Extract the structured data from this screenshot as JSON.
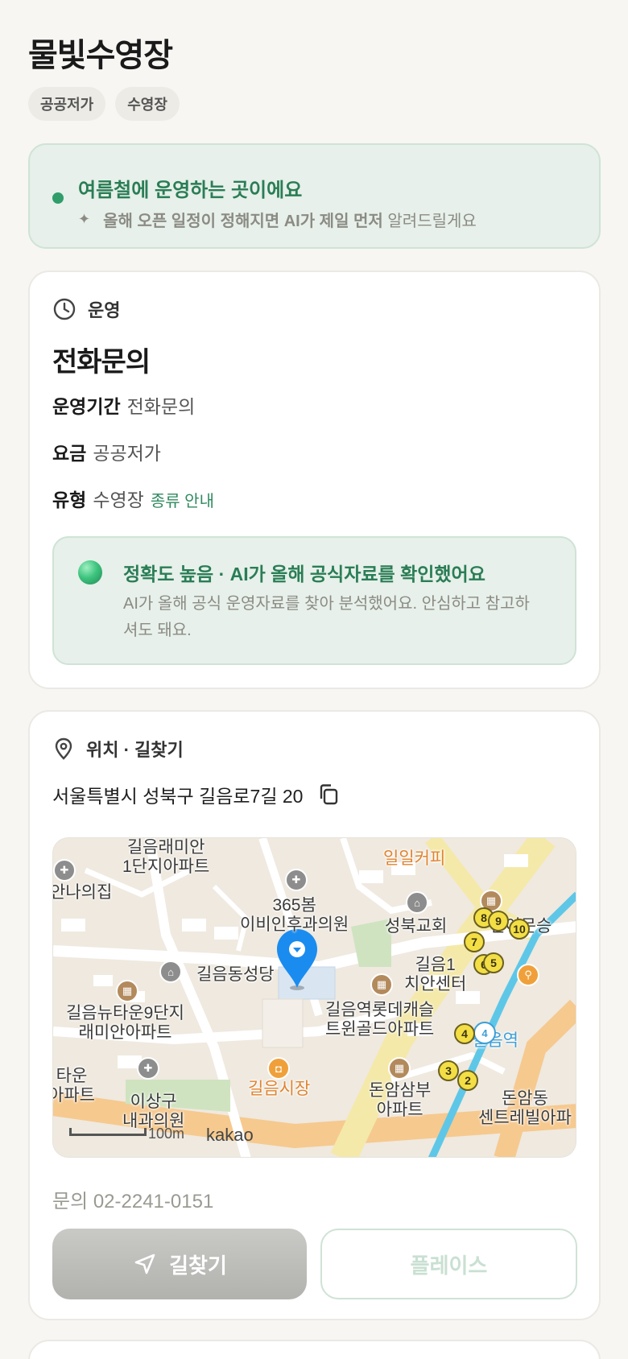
{
  "page": {
    "title": "물빛수영장"
  },
  "tags": [
    "공공저가",
    "수영장"
  ],
  "notice": {
    "headline": "여름철에 운영하는 곳이에요",
    "sub_bold": "올해 오픈 일정이 정해지면 AI가 제일 먼저",
    "sub_rest": "알려드릴게요"
  },
  "operation": {
    "section_label": "운영",
    "status": "전화문의",
    "period_key": "운영기간",
    "period_value": "전화문의",
    "fee_key": "요금",
    "fee_value": "공공저가",
    "type_key": "유형",
    "type_value": "수영장",
    "type_link": "종류 안내",
    "accuracy_title": "정확도 높음 · AI가 올해 공식자료를 확인했어요",
    "accuracy_text": "AI가 올해 공식 운영자료를 찾아 분석했어요. 안심하고 참고하셔도 돼요."
  },
  "location": {
    "section_label": "위치 · 길찾기",
    "address": "서울특별시 성북구 길음로7길 20",
    "phone": "문의 02-2241-0151",
    "map": {
      "labels": {
        "apt1": "길음래미안\n1단지아파트",
        "cafe": "일일커피",
        "nanaui": "안나의집",
        "clinic": "365봄\n이비인후과의원",
        "church": "성북교회",
        "sinsun": "신이문승",
        "gileum1": "길음1\n치안센터",
        "cathedral": "길음동성당",
        "newtown": "길음뉴타운9단지\n래미안아파트",
        "lotte": "길음역롯데캐슬\n트윈골드아파트",
        "station": "길음역",
        "taun": "타운\n아파트",
        "isang": "이상구\n내과의원",
        "market": "길음시장",
        "donam": "돈암삼부\n아파트",
        "donam2": "돈암동\n센트레빌아파",
        "kakao": "kakao",
        "scale": "100m"
      },
      "subway_line": "4",
      "exit_numbers": [
        "8",
        "9",
        "10",
        "7",
        "6",
        "5",
        "3",
        "2",
        "4"
      ]
    }
  },
  "actions": {
    "navigate": "길찾기",
    "place": "플레이스"
  },
  "colors": {
    "accent_green": "#2a7d55",
    "notice_bg": "#e7f0ea",
    "pin_blue": "#1a8cf0",
    "map_bg": "#efe9df"
  },
  "icons": {
    "operation": "clock-icon",
    "location": "map-pin-icon",
    "copy": "copy-icon",
    "navigate": "navigation-arrow-icon",
    "notice_dot": "status-dot-icon",
    "sparkle": "sparkle-icon"
  }
}
